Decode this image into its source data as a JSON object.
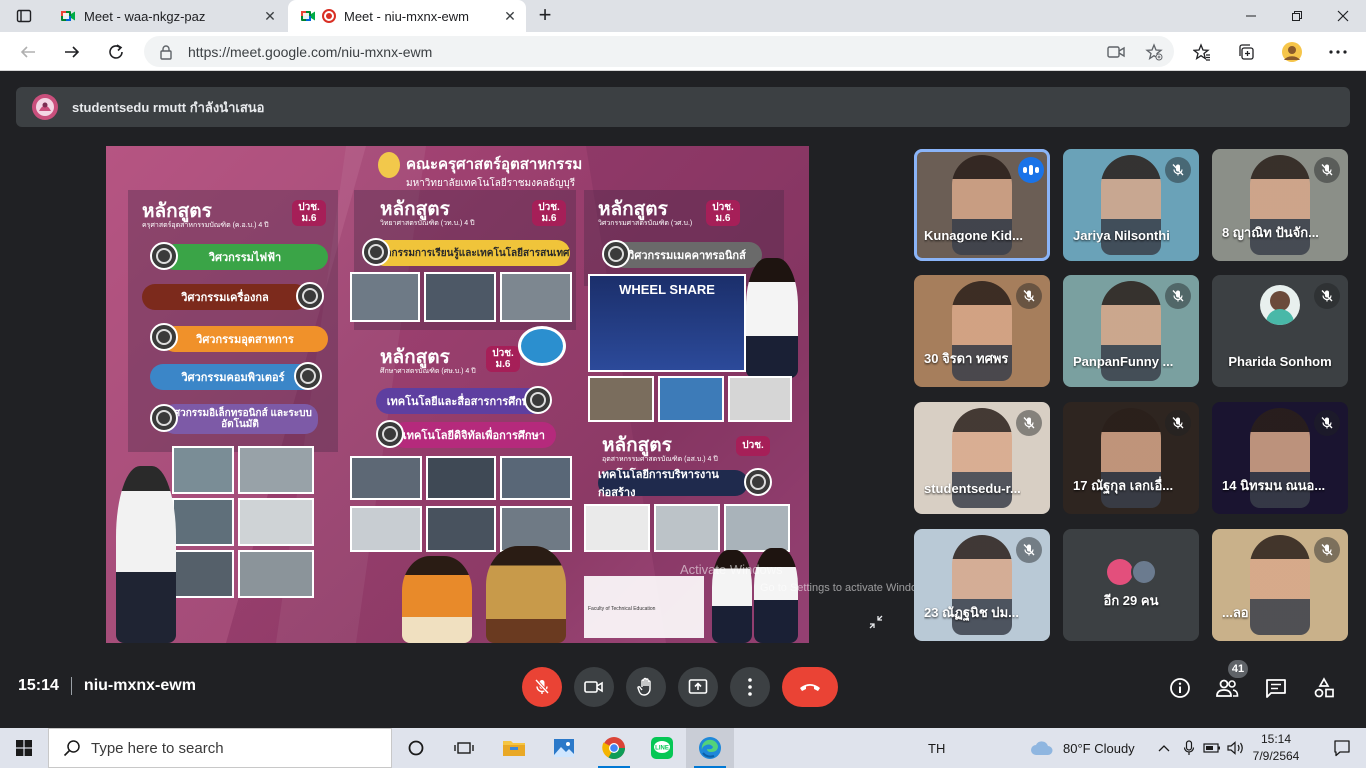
{
  "browser": {
    "tabs": [
      {
        "title": "Meet - waa-nkgz-paz",
        "active": false
      },
      {
        "title": "Meet - niu-mxnx-ewm",
        "active": true
      }
    ],
    "url": "https://meet.google.com/niu-mxnx-ewm"
  },
  "presenter_bar": {
    "label": "studentsedu rmutt กำลังนำเสนอ"
  },
  "presentation": {
    "header_line1": "คณะครุศาสตร์อุตสาหกรรม",
    "header_line2": "มหาวิทยาลัยเทคโนโลยีราชมงคลธัญบุรี",
    "columns": [
      {
        "title": "หลักสูตร",
        "subtitle": "ครุศาสตร์อุตสาหกรรมบัณฑิต (ค.อ.บ.) 4 ปี",
        "badge": "ปวช. ม.6",
        "items": [
          "วิศวกรรมไฟฟ้า",
          "วิศวกรรมเครื่องกล",
          "วิศวกรรมอุตสาหการ",
          "วิศวกรรมคอมพิวเตอร์",
          "วิศวกรรมอิเล็กทรอนิกส์ และระบบอัตโนมัติ"
        ]
      },
      {
        "title": "หลักสูตร",
        "subtitle": "วิทยาศาสตรบัณฑิต (วท.บ.) 4 ปี",
        "badge": "ปวช. ม.6",
        "items": [
          "นวัตกรรมการเรียนรู้และเทคโนโลยีสารสนเทศ"
        ]
      },
      {
        "title": "หลักสูตร",
        "subtitle": "ศึกษาศาสตรบัณฑิต (ศษ.บ.) 4 ปี",
        "badge": "ปวช. ม.6",
        "items": [
          "เทคโนโลยีและสื่อสารการศึกษา",
          "เทคโนโลยีดิจิทัลเพื่อการศึกษา"
        ]
      },
      {
        "title": "หลักสูตร",
        "subtitle": "วิศวกรรมศาสตรบัณฑิต (วศ.บ.)",
        "badge": "ปวช. ม.6",
        "items": [
          "วิศวกรรมเมคคาทรอนิกส์"
        ]
      },
      {
        "title": "หลักสูตร",
        "subtitle": "อุตสาหกรรมศาสตรบัณฑิต (อส.บ.) 4 ปี",
        "badge": "ปวช.",
        "items": [
          "เทคโนโลยีการบริหารงานก่อสร้าง"
        ]
      }
    ],
    "banner": "WHEEL SHARE",
    "footer_contact": "Faculty of Technical Education",
    "watermark_1": "Activate Windows",
    "watermark_2": "Go to Settings to activate Windows."
  },
  "participants": [
    {
      "name": "Kunagone Kid...",
      "speaking": true,
      "muted": false,
      "bg": "#6b5e55"
    },
    {
      "name": "Jariya Nilsonthi",
      "speaking": false,
      "muted": true,
      "bg": "#6aa2b8"
    },
    {
      "name": "8 ญาณิท ปันจัก...",
      "speaking": false,
      "muted": true,
      "bg": "#8b8f88"
    },
    {
      "name": "30 จิรดา ทศพร",
      "speaking": false,
      "muted": true,
      "bg": "#a67e5c"
    },
    {
      "name": "PanpanFunny ...",
      "speaking": false,
      "muted": true,
      "bg": "#7aa0a0"
    },
    {
      "name": "Pharida Sonhom",
      "speaking": false,
      "muted": true,
      "bg": "#3c4043",
      "avatar": true
    },
    {
      "name": "studentsedu-r...",
      "speaking": false,
      "muted": true,
      "bg": "#d8cfc4"
    },
    {
      "name": "17 ณัฐกุล เลกเอื่...",
      "speaking": false,
      "muted": true,
      "bg": "#2e2520"
    },
    {
      "name": "14 นิทรมน ณนอ...",
      "speaking": false,
      "muted": true,
      "bg": "#1a1430"
    },
    {
      "name": "23 ณัฏฐนิช บ่ม...",
      "speaking": false,
      "muted": true,
      "bg": "#b9c9d6"
    },
    {
      "name": "อีก 29 คน",
      "speaking": false,
      "muted": false,
      "bg": "#3c4043",
      "others": true
    },
    {
      "name": "...ลอ",
      "speaking": false,
      "muted": true,
      "bg": "#c9b18a"
    }
  ],
  "controls": {
    "time": "15:14",
    "meeting_code": "niu-mxnx-ewm",
    "participant_count": "41"
  },
  "taskbar": {
    "search_placeholder": "Type here to search",
    "language": "TH",
    "weather": "80°F  Cloudy",
    "clock_time": "15:14",
    "clock_date": "7/9/2564"
  }
}
